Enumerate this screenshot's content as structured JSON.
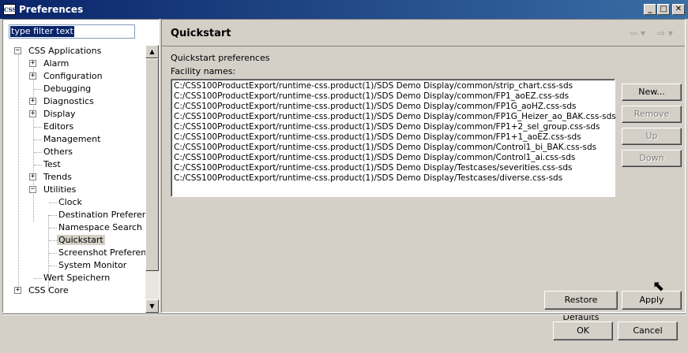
{
  "window": {
    "title": "Preferences",
    "app_icon_text": "CSS",
    "minimize_glyph": "_",
    "maximize_glyph": "□",
    "close_glyph": "✕"
  },
  "filter": {
    "value": "type filter text"
  },
  "tree": {
    "items": [
      {
        "label": "CSS Applications",
        "expander": "−"
      },
      {
        "label": "Alarm",
        "expander": "+"
      },
      {
        "label": "Configuration",
        "expander": "+"
      },
      {
        "label": "Debugging",
        "expander": ""
      },
      {
        "label": "Diagnostics",
        "expander": "+"
      },
      {
        "label": "Display",
        "expander": "+"
      },
      {
        "label": "Editors",
        "expander": ""
      },
      {
        "label": "Management",
        "expander": ""
      },
      {
        "label": "Others",
        "expander": ""
      },
      {
        "label": "Test",
        "expander": ""
      },
      {
        "label": "Trends",
        "expander": "+"
      },
      {
        "label": "Utilities",
        "expander": "−"
      },
      {
        "label": "Clock",
        "expander": ""
      },
      {
        "label": "Destination Preference",
        "expander": ""
      },
      {
        "label": "Namespace Search",
        "expander": ""
      },
      {
        "label": "Quickstart",
        "expander": "",
        "selected": true
      },
      {
        "label": "Screenshot Preference",
        "expander": ""
      },
      {
        "label": "System Monitor",
        "expander": ""
      },
      {
        "label": "Wert Speichern",
        "expander": ""
      },
      {
        "label": "CSS Core",
        "expander": "+"
      }
    ]
  },
  "page": {
    "title": "Quickstart",
    "back_icon": "back-arrow-icon",
    "forward_icon": "forward-arrow-icon",
    "description": "Quickstart preferences",
    "list_label": "Facility names:",
    "list_items": [
      "C:/CSS100ProductExport/runtime-css.product(1)/SDS Demo Display/common/strip_chart.css-sds",
      "C:/CSS100ProductExport/runtime-css.product(1)/SDS Demo Display/common/FP1_aoEZ.css-sds",
      "C:/CSS100ProductExport/runtime-css.product(1)/SDS Demo Display/common/FP1G_aoHZ.css-sds",
      "C:/CSS100ProductExport/runtime-css.product(1)/SDS Demo Display/common/FP1G_Heizer_ao_BAK.css-sds",
      "C:/CSS100ProductExport/runtime-css.product(1)/SDS Demo Display/common/FP1+2_sel_group.css-sds",
      "C:/CSS100ProductExport/runtime-css.product(1)/SDS Demo Display/common/FP1+1_aoEZ.css-sds",
      "C:/CSS100ProductExport/runtime-css.product(1)/SDS Demo Display/common/Control1_bi_BAK.css-sds",
      "C:/CSS100ProductExport/runtime-css.product(1)/SDS Demo Display/common/Control1_ai.css-sds",
      "C:/CSS100ProductExport/runtime-css.product(1)/SDS Demo Display/Testcases/severities.css-sds",
      "C:/CSS100ProductExport/runtime-css.product(1)/SDS Demo Display/Testcases/diverse.css-sds"
    ],
    "buttons": {
      "new": "New...",
      "remove": "Remove",
      "up": "Up",
      "down": "Down",
      "restore_defaults": "Restore Defaults",
      "apply": "Apply"
    }
  },
  "dialog": {
    "ok": "OK",
    "cancel": "Cancel"
  }
}
